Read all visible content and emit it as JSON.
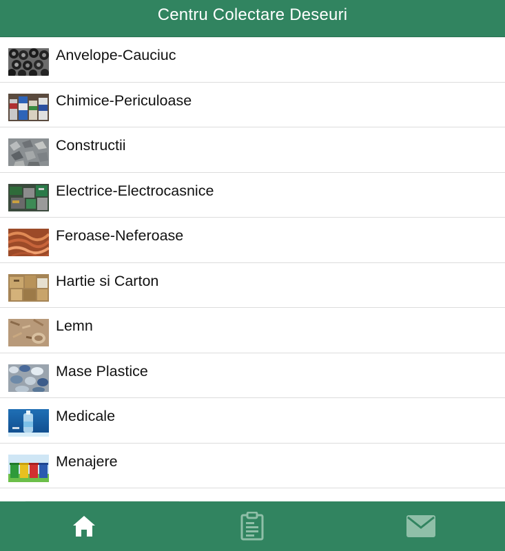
{
  "header": {
    "title": "Centru Colectare Deseuri"
  },
  "categories": [
    {
      "label": "Anvelope-Cauciuc",
      "icon": "tires-thumbnail"
    },
    {
      "label": "Chimice-Periculoase",
      "icon": "chemicals-thumbnail"
    },
    {
      "label": "Constructii",
      "icon": "construction-thumbnail"
    },
    {
      "label": "Electrice-Electrocasnice",
      "icon": "electronics-thumbnail"
    },
    {
      "label": "Feroase-Neferoase",
      "icon": "metals-thumbnail"
    },
    {
      "label": "Hartie si Carton",
      "icon": "paper-cardboard-thumbnail"
    },
    {
      "label": "Lemn",
      "icon": "wood-thumbnail"
    },
    {
      "label": "Mase Plastice",
      "icon": "plastics-thumbnail"
    },
    {
      "label": "Medicale",
      "icon": "medical-thumbnail"
    },
    {
      "label": "Menajere",
      "icon": "household-bins-thumbnail"
    }
  ],
  "tabbar": {
    "tabs": [
      {
        "icon": "home-icon",
        "active": true
      },
      {
        "icon": "clipboard-icon",
        "active": false
      },
      {
        "icon": "mail-icon",
        "active": false
      }
    ]
  },
  "colors": {
    "primary": "#318460",
    "tab_active": "#ffffff",
    "tab_inactive": "#8fbfa8",
    "divider": "#dcdcdc"
  }
}
